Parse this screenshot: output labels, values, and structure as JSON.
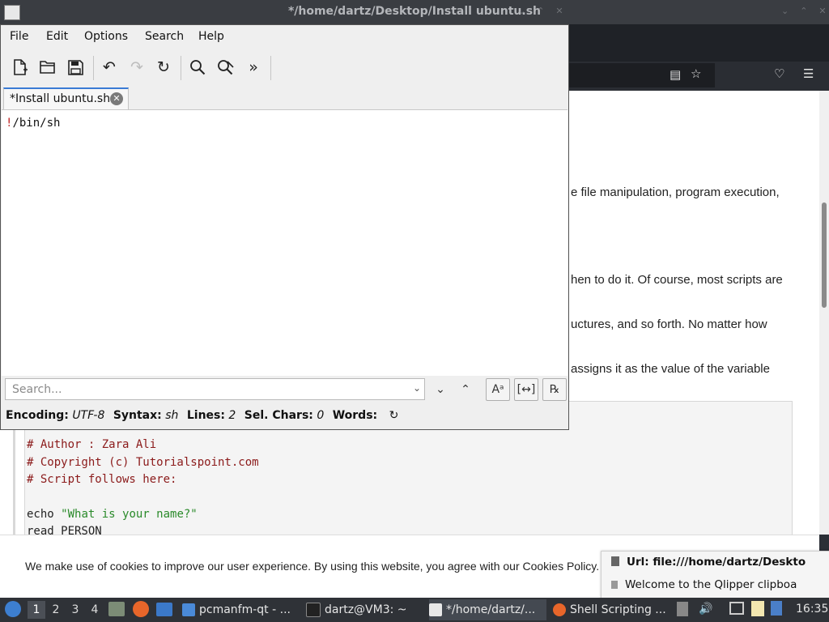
{
  "window": {
    "title": "*/home/dartz/Desktop/Install ubuntu.sh"
  },
  "menu": [
    "File",
    "Edit",
    "Options",
    "Search",
    "Help"
  ],
  "tab": {
    "label": "*Install ubuntu.sh"
  },
  "editor": {
    "line1_bang": "!",
    "line1_rest": "/bin/sh"
  },
  "search": {
    "placeholder": "Search..."
  },
  "status": {
    "encoding_label": "Encoding:",
    "encoding": "UTF-8",
    "syntax_label": "Syntax:",
    "syntax": "sh",
    "lines_label": "Lines:",
    "lines": "2",
    "selchars_label": "Sel. Chars:",
    "selchars": "0",
    "words_label": "Words:"
  },
  "webpage": {
    "fragments": [
      "e file manipulation, program execution,",
      "hen to do it. Of course, most scripts are",
      "uctures,  and  so  forth.  No  matter  how",
      "assigns it as the value of the variable"
    ],
    "code": {
      "c1": "# Author : Zara Ali",
      "c2": "# Copyright (c) Tutorialspoint.com",
      "c3": "# Script follows here:",
      "echo_cmd": "echo ",
      "echo_str": "\"What is your name?\"",
      "read": "read PERSON"
    },
    "cookie": "We make use of cookies to improve our user experience. By using this website, you agree with our Cookies Policy."
  },
  "clipboard": {
    "url": "Url: file:///home/dartz/Deskto",
    "welcome": "Welcome to the Qlipper clipboa"
  },
  "taskbar": {
    "desktops": [
      "1",
      "2",
      "3",
      "4"
    ],
    "tasks": [
      "pcmanfm-qt - ...",
      "dartz@VM3: ~",
      "*/home/dartz/...",
      "Shell Scripting ..."
    ],
    "clock": "16:35"
  }
}
